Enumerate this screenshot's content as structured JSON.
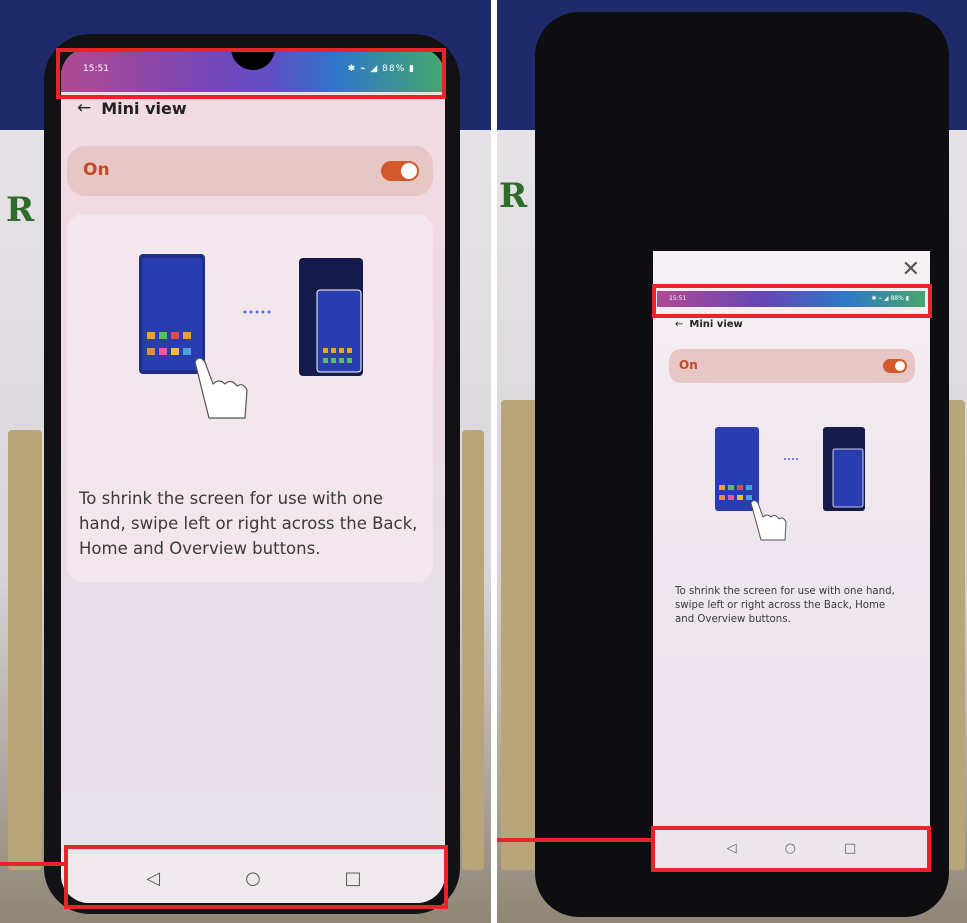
{
  "left": {
    "status_time": "15:51",
    "status_icons": "✱ ⌁ ◢ 88% ▮",
    "back_glyph": "←",
    "title": "Mini view",
    "toggle_label": "On",
    "description": "To shrink the screen for use with one hand, swipe left or right across the Back, Home and Overview buttons.",
    "nav": {
      "back": "◁",
      "home": "○",
      "overview": "□"
    }
  },
  "right": {
    "close_glyph": "✕",
    "status_time": "15:51",
    "status_icons": "✱ ⌁ ◢ 88% ▮",
    "back_glyph": "←",
    "title": "Mini view",
    "toggle_label": "On",
    "description": "To shrink the screen for use with one hand, swipe left or right across the Back, Home and Overview buttons.",
    "nav": {
      "back": "◁",
      "home": "○",
      "overview": "□"
    }
  },
  "colors": {
    "highlight": "#e8242b",
    "toggle_on": "#d25a2a",
    "on_label": "#c24a24"
  },
  "icons": [
    "back-arrow-icon",
    "toggle-switch",
    "nav-back-icon",
    "nav-home-icon",
    "nav-overview-icon",
    "close-icon",
    "hand-swipe-illustration"
  ]
}
